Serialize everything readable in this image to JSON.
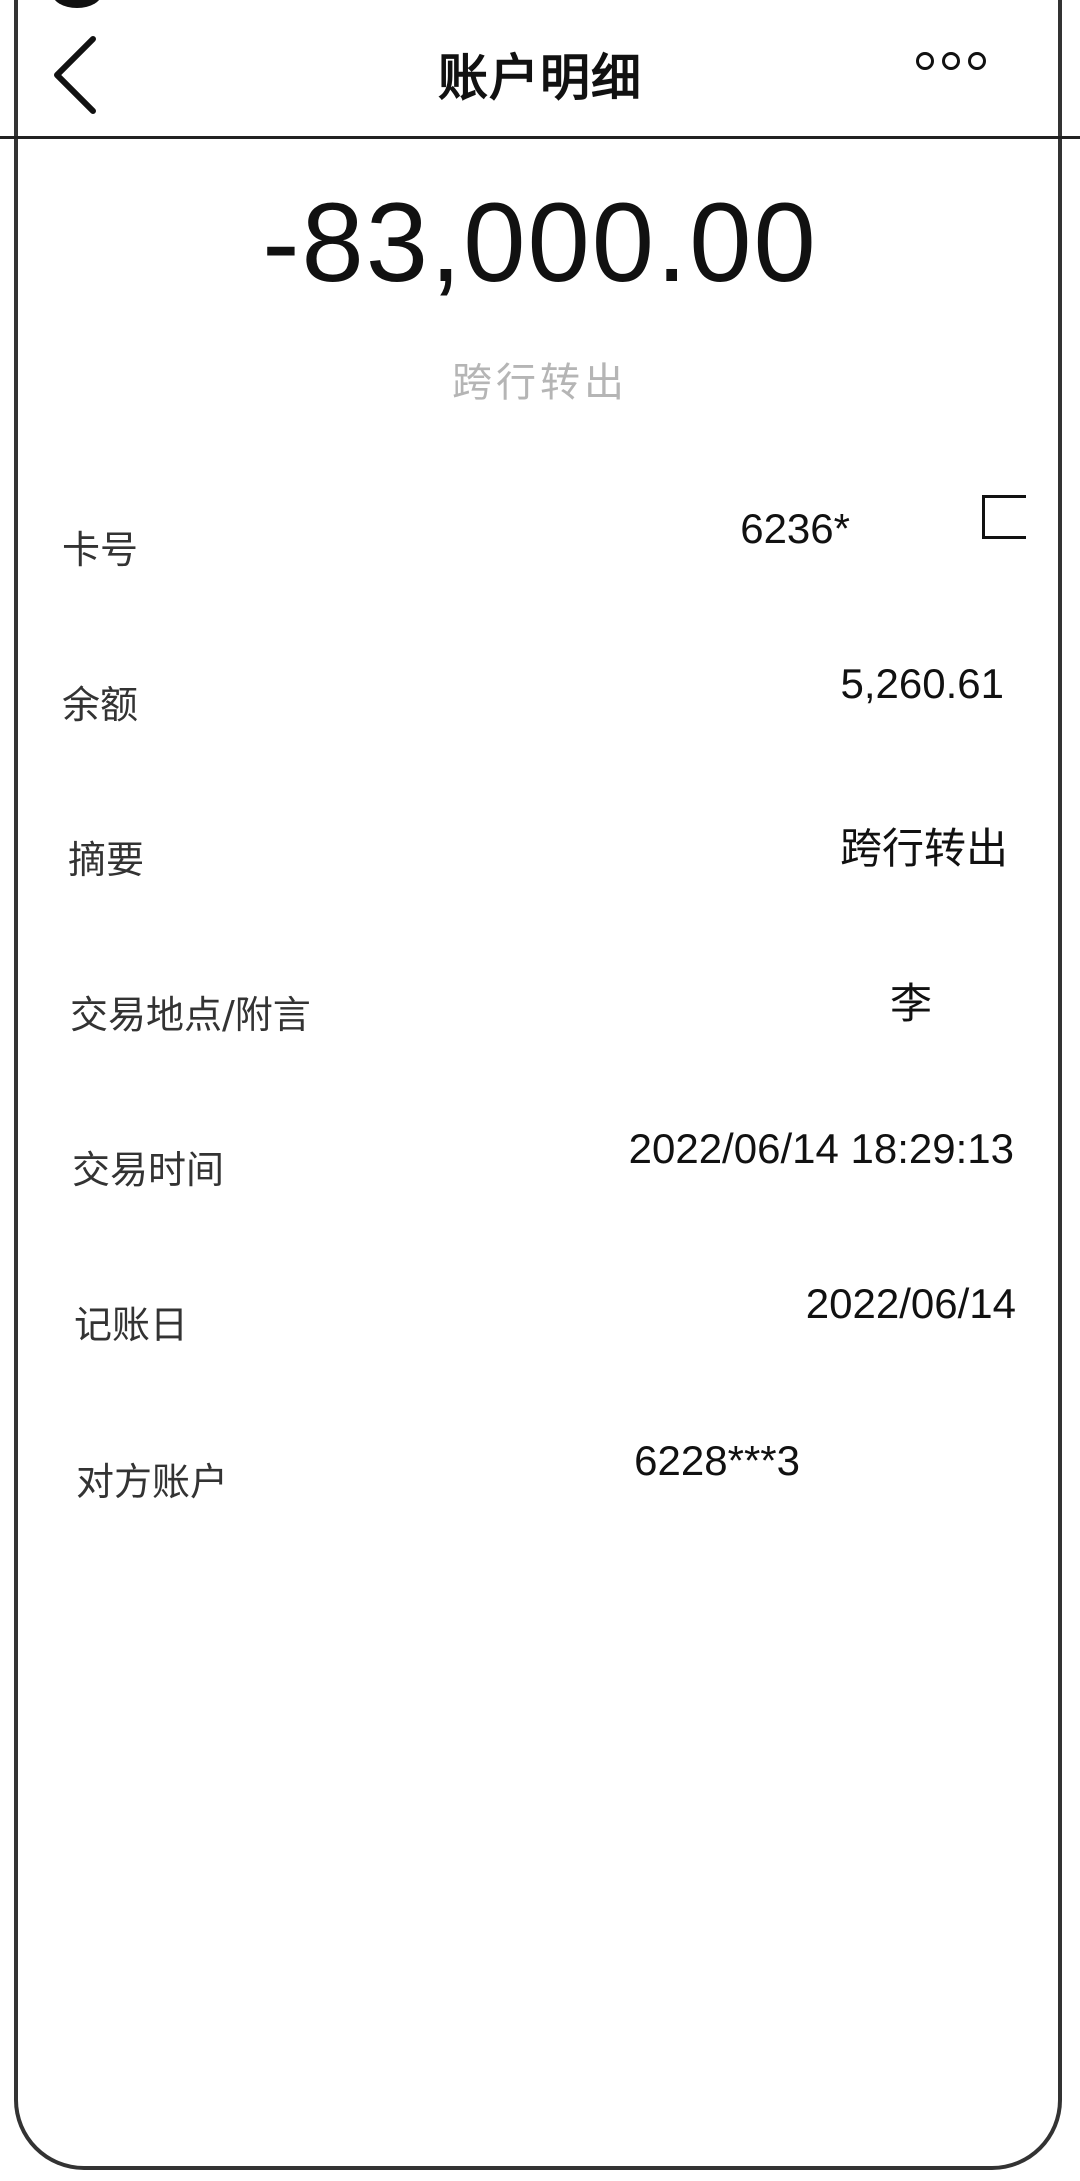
{
  "navbar": {
    "title": "账户明细"
  },
  "transaction": {
    "amount": "-83,000.00",
    "status": "跨行转出"
  },
  "details": [
    {
      "label": "卡号",
      "value": "6236*"
    },
    {
      "label": "余额",
      "value": "5,260.61"
    },
    {
      "label": "摘要",
      "value": "跨行转出"
    },
    {
      "label": "交易地点/附言",
      "value": "李"
    },
    {
      "label": "交易时间",
      "value": "2022/06/14 18:29:13"
    },
    {
      "label": "记账日",
      "value": "2022/06/14"
    },
    {
      "label": "对方账户",
      "value": "6228***3"
    }
  ]
}
